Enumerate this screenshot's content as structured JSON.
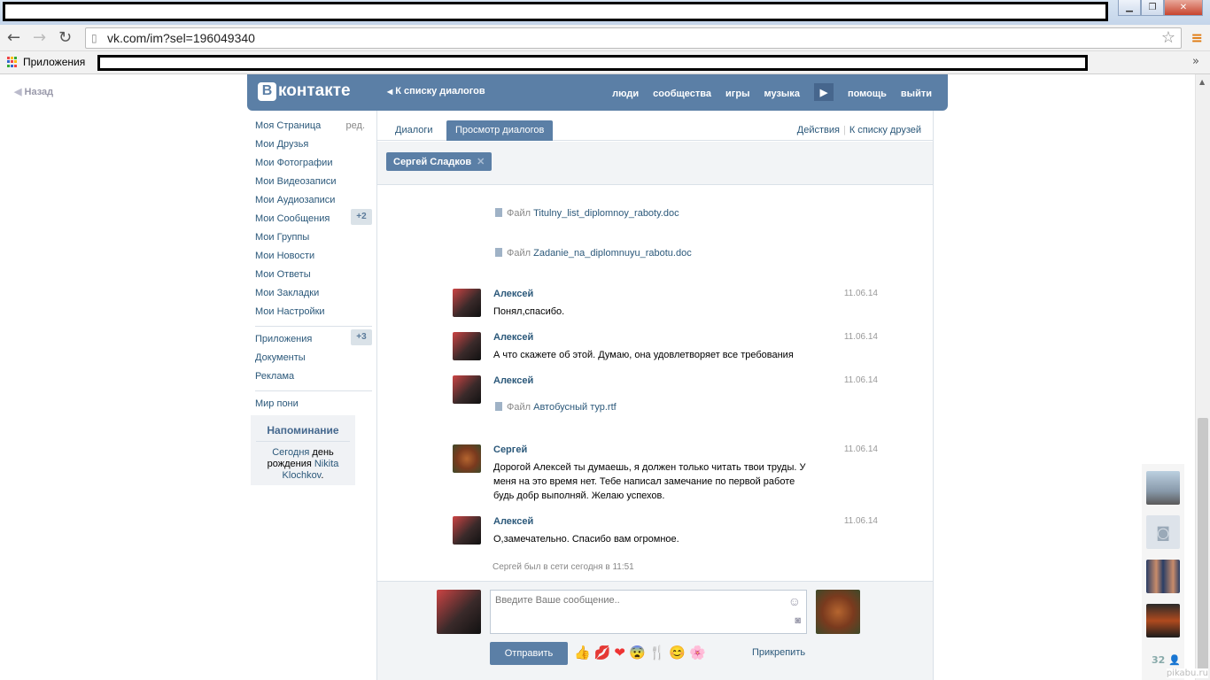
{
  "browser": {
    "url": "vk.com/im?sel=196049340",
    "bookmarks_apps_label": "Приложения",
    "back_icon": "back-arrow-icon",
    "forward_icon": "forward-arrow-icon",
    "reload_icon": "reload-icon",
    "chevron": "»"
  },
  "page_back": "Назад",
  "header": {
    "logo_b": "В",
    "logo_text": "контакте",
    "back_to_list": "К списку диалогов",
    "nav": [
      "люди",
      "сообщества",
      "игры",
      "музыка",
      "помощь",
      "выйти"
    ],
    "accent": "#5b7fa6"
  },
  "sidebar": {
    "items": [
      {
        "label": "Моя Страница",
        "extra": "ред."
      },
      {
        "label": "Мои Друзья"
      },
      {
        "label": "Мои Фотографии"
      },
      {
        "label": "Мои Видеозаписи"
      },
      {
        "label": "Мои Аудиозаписи"
      },
      {
        "label": "Мои Сообщения",
        "badge": "+2"
      },
      {
        "label": "Мои Группы"
      },
      {
        "label": "Мои Новости"
      },
      {
        "label": "Мои Ответы"
      },
      {
        "label": "Мои Закладки"
      },
      {
        "label": "Мои Настройки"
      }
    ],
    "items2": [
      {
        "label": "Приложения",
        "badge": "+3"
      },
      {
        "label": "Документы"
      },
      {
        "label": "Реклама"
      }
    ],
    "items3": [
      {
        "label": "Мир пони"
      }
    ],
    "reminder": {
      "title": "Напоминание",
      "today": "Сегодня",
      "mid": " день рождения ",
      "name": "Nikita Klochkov",
      "end": "."
    }
  },
  "tabs": {
    "dialogs": "Диалоги",
    "view": "Просмотр диалогов",
    "actions": "Действия",
    "divider": "|",
    "to_friends": "К списку друзей"
  },
  "peer": {
    "name": "Сергей Сладков",
    "close": "✕"
  },
  "history": {
    "files_top": [
      {
        "prefix": "Файл",
        "name": "Titulny_list_diplomnoy_raboty.doc"
      },
      {
        "prefix": "Файл",
        "name": "Zadanie_na_diplomnuyu_rabotu.doc"
      }
    ],
    "messages": [
      {
        "author": "Алексей",
        "date": "11.06.14",
        "text": "Понял,спасибо."
      },
      {
        "author": "Алексей",
        "date": "11.06.14",
        "text": "А что скажете об этой. Думаю, она удовлетворяет все требования"
      },
      {
        "author": "Алексей",
        "date": "11.06.14",
        "file_prefix": "Файл",
        "file": "Автобусный тур.rtf"
      },
      {
        "author": "Сергей",
        "date": "11.06.14",
        "text": "Дорогой Алексей ты думаешь, я должен только читать твои труды. У меня на это время нет. Тебе написал замечание по первой работе будь добр выполняй. Желаю успехов."
      },
      {
        "author": "Алексей",
        "date": "11.06.14",
        "text": "О,замечательно. Спасибо вам огромное."
      }
    ],
    "online_status": "Сергей был в сети сегодня в 11:51"
  },
  "compose": {
    "placeholder": "Введите Ваше сообщение..",
    "send": "Отправить",
    "attach": "Прикрепить",
    "emojis": [
      "👍",
      "💋",
      "❤",
      "😨",
      "🍴",
      "😊",
      "🌸"
    ]
  },
  "rightcol": {
    "count": "32"
  },
  "watermark": "pikabu.ru"
}
